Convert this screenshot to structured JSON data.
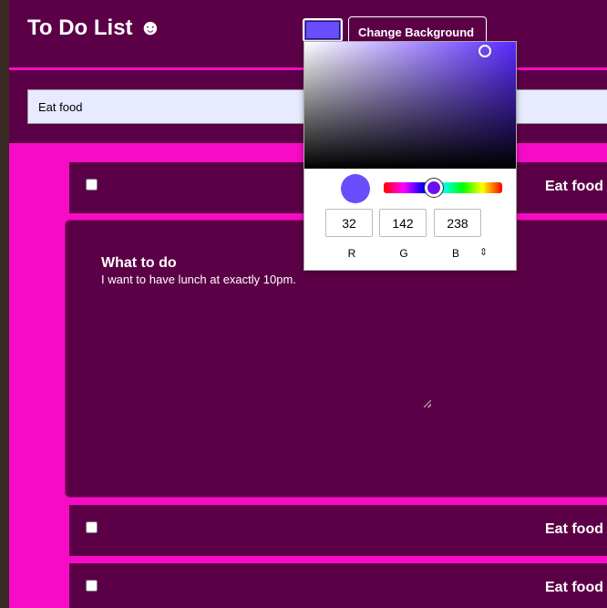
{
  "header": {
    "title": "To Do List ☻",
    "change_background_label": "Change Background",
    "swatch_color": "#6a4dfc"
  },
  "input": {
    "value": "Eat food"
  },
  "todos": [
    {
      "label": "Eat food",
      "checked": false
    },
    {
      "label": "Eat food",
      "checked": false
    },
    {
      "label": "Eat food",
      "checked": false
    }
  ],
  "detail": {
    "heading": "What to do",
    "text": "I want to have lunch at exactly 10pm."
  },
  "color_picker": {
    "r": "32",
    "g": "142",
    "b": "238",
    "label_r": "R",
    "label_g": "G",
    "label_b": "B",
    "mode_toggle_icon": "up-down-arrows-icon",
    "mode_toggle_glyph": "⇕"
  },
  "colors": {
    "page_accent": "#f70bc6",
    "panel_bg": "#5b0046"
  }
}
